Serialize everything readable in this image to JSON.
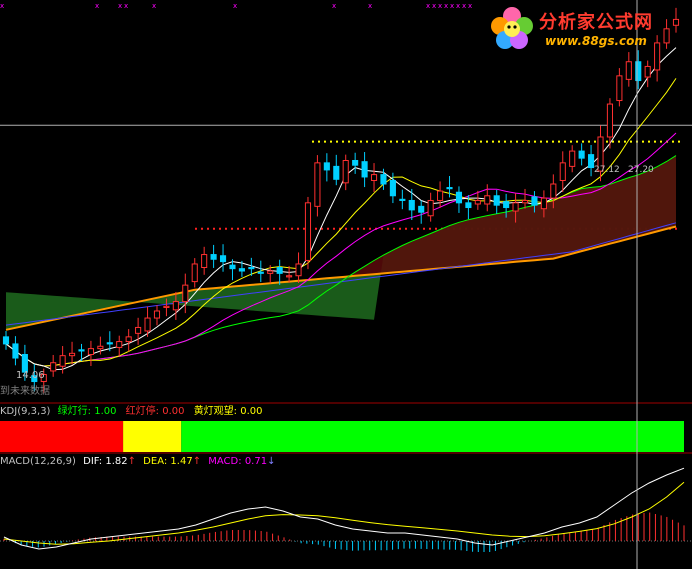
{
  "watermark": {
    "title": "分析家公式网",
    "url": "www.88gs.com"
  },
  "main": {
    "low_label": "14.06",
    "cursor_value_left": "27.12",
    "cursor_value_right": "27.20",
    "future_label": "到未来数据"
  },
  "kdj_panel": {
    "title": "KDJ(9,3,3)",
    "green_label": "绿灯行:",
    "green_value": "1.00",
    "red_label": "红灯停:",
    "red_value": "0.00",
    "yellow_label": "黄灯观望:",
    "yellow_value": "0.00",
    "colors": {
      "green": "#00ff00",
      "red": "#ff0000",
      "yellow": "#ffff00"
    }
  },
  "macd_panel": {
    "title": "MACD(12,26,9)",
    "dif_label": "DIF:",
    "dif_value": "1.82",
    "dea_label": "DEA:",
    "dea_value": "1.47",
    "macd_label": "MACD:",
    "macd_value": "0.71",
    "colors": {
      "dif": "#ffffff",
      "dea": "#ffff00",
      "macd": "#ff00ff"
    }
  },
  "chart_data": [
    {
      "type": "candlestick",
      "title": "",
      "ylim": [
        13.5,
        30
      ],
      "price_levels": {
        "upper_dotted_yellow": 24.4,
        "lower_dotted_red": 20.7,
        "cursor_hline": 25.1
      },
      "low_marker": 14.06,
      "closes": [
        15.8,
        15.2,
        14.6,
        14.2,
        14.5,
        15.0,
        15.3,
        15.4,
        15.5,
        15.6,
        15.7,
        15.8,
        15.9,
        16.1,
        16.5,
        16.9,
        17.2,
        17.4,
        17.6,
        18.3,
        19.2,
        19.6,
        19.4,
        19.3,
        19.0,
        18.9,
        19.0,
        18.8,
        18.9,
        18.8,
        18.7,
        19.2,
        21.8,
        23.5,
        23.2,
        22.8,
        23.6,
        23.4,
        22.9,
        23.0,
        22.6,
        22.1,
        21.9,
        21.5,
        21.4,
        21.9,
        22.3,
        22.4,
        21.8,
        21.6,
        21.9,
        22.1,
        21.7,
        21.6,
        21.8,
        21.9,
        21.7,
        22.0,
        22.6,
        23.5,
        24.0,
        23.7,
        23.3,
        24.6,
        26.0,
        27.2,
        27.8,
        27.0,
        27.6,
        28.6,
        29.2,
        29.6
      ],
      "series_colors": {
        "ma5": "#ffffff",
        "ma10": "#ffff00",
        "ma20": "#ff00ff",
        "ma30": "#00ff00",
        "ma60": "#4040ff",
        "ma120": "#ff9900"
      }
    },
    {
      "type": "bar",
      "title": "",
      "segments": [
        {
          "label": "红灯停",
          "color": "#ff0000",
          "fraction": 0.18
        },
        {
          "label": "黄灯观望",
          "color": "#ffff00",
          "fraction": 0.085
        },
        {
          "label": "绿灯行",
          "color": "#00ff00",
          "fraction": 0.735
        }
      ]
    },
    {
      "type": "line",
      "title": "",
      "series": [
        {
          "name": "DIF",
          "values": [
            0.1,
            -0.1,
            -0.2,
            -0.15,
            -0.05,
            0.05,
            0.1,
            0.15,
            0.2,
            0.25,
            0.3,
            0.4,
            0.55,
            0.7,
            0.8,
            0.85,
            0.75,
            0.6,
            0.55,
            0.4,
            0.3,
            0.25,
            0.2,
            0.2,
            0.15,
            0.1,
            0.05,
            -0.05,
            -0.1,
            0.0,
            0.1,
            0.2,
            0.35,
            0.45,
            0.6,
            0.9,
            1.2,
            1.45,
            1.65,
            1.82
          ]
        },
        {
          "name": "DEA",
          "values": [
            0.05,
            0.0,
            -0.05,
            -0.08,
            -0.07,
            -0.03,
            0.0,
            0.05,
            0.1,
            0.15,
            0.2,
            0.27,
            0.35,
            0.45,
            0.55,
            0.63,
            0.66,
            0.65,
            0.63,
            0.58,
            0.52,
            0.46,
            0.41,
            0.37,
            0.33,
            0.29,
            0.25,
            0.2,
            0.15,
            0.12,
            0.11,
            0.13,
            0.18,
            0.24,
            0.31,
            0.43,
            0.6,
            0.8,
            1.1,
            1.47
          ]
        },
        {
          "name": "MACD",
          "values": [
            0.1,
            -0.2,
            -0.3,
            -0.14,
            0.04,
            0.16,
            0.2,
            0.2,
            0.2,
            0.2,
            0.2,
            0.26,
            0.4,
            0.5,
            0.5,
            0.44,
            0.18,
            -0.1,
            -0.16,
            -0.36,
            -0.44,
            -0.42,
            -0.42,
            -0.34,
            -0.36,
            -0.38,
            -0.4,
            -0.5,
            -0.5,
            -0.24,
            -0.02,
            0.14,
            0.34,
            0.42,
            0.58,
            0.94,
            1.2,
            1.3,
            1.1,
            0.71
          ]
        }
      ]
    }
  ]
}
